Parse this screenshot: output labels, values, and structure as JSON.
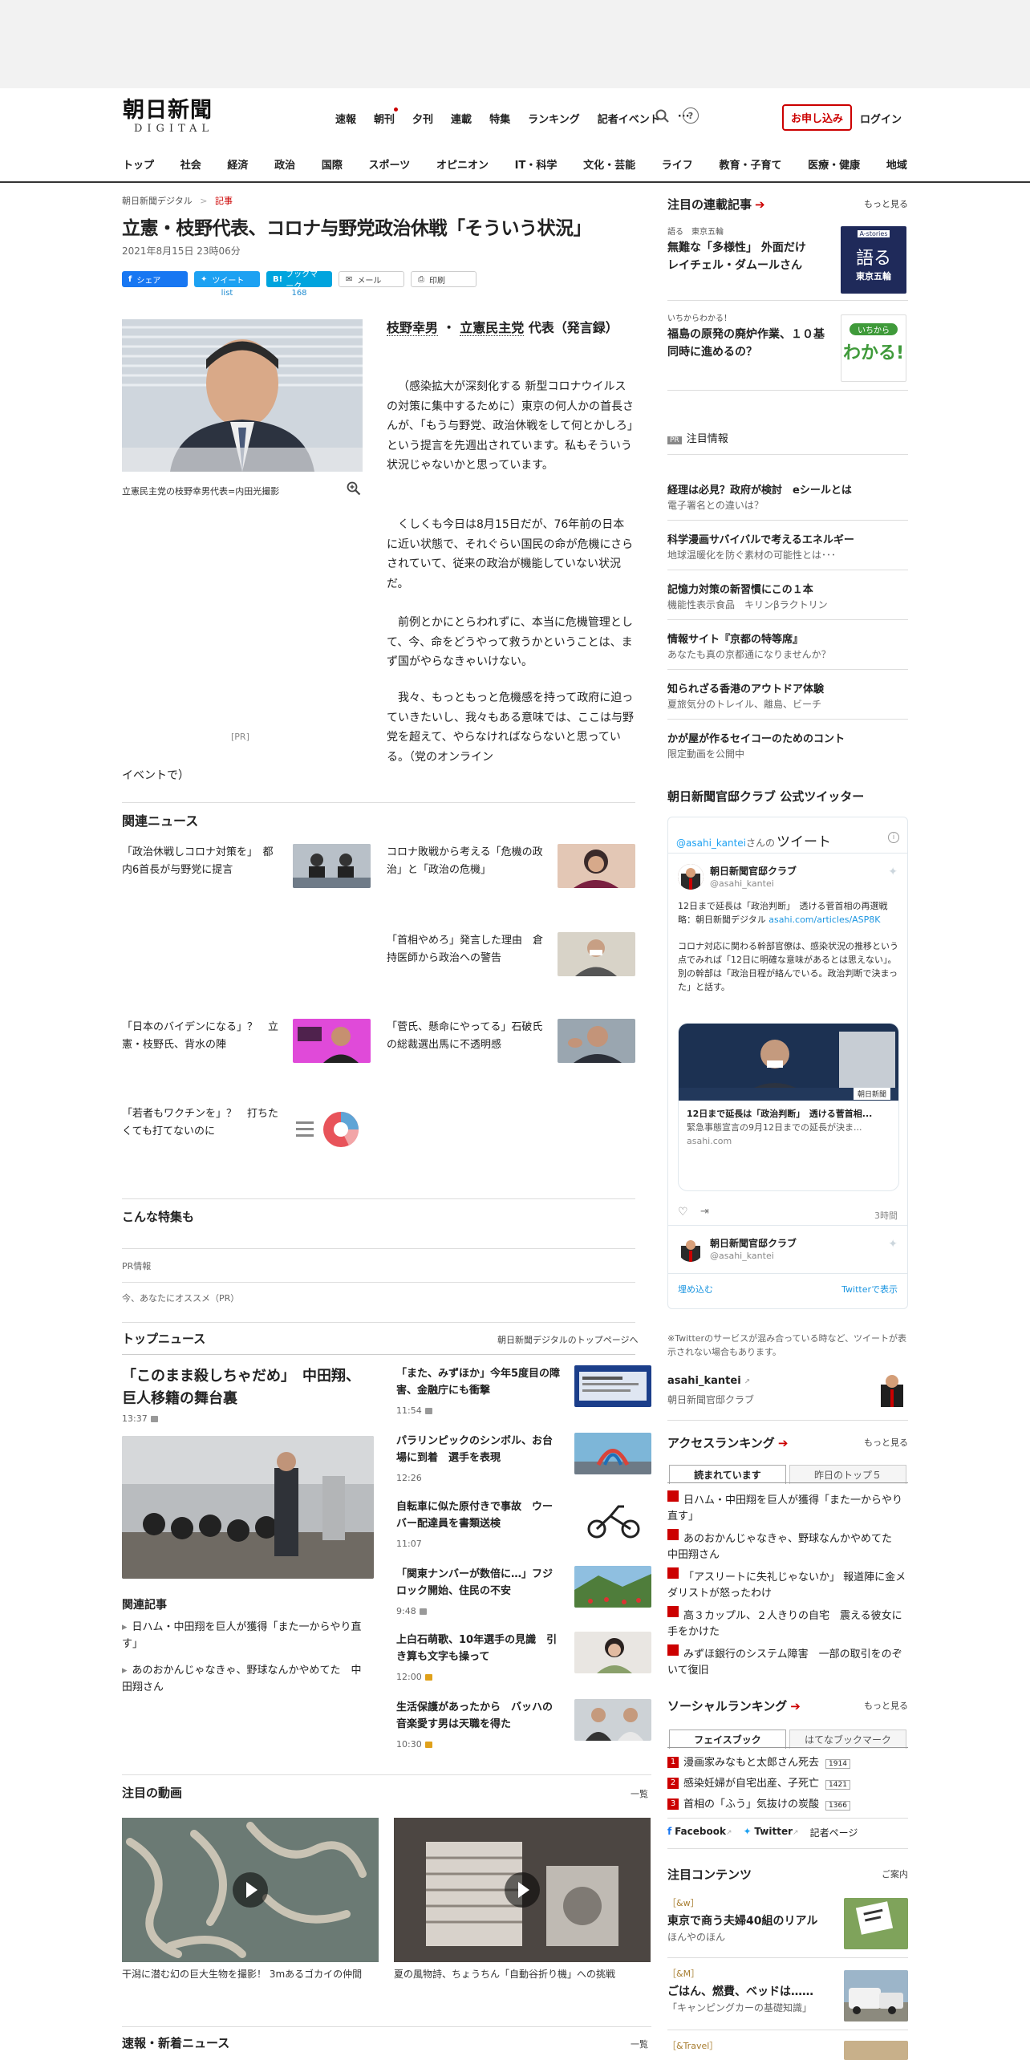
{
  "header": {
    "logo_jp": "朝日新聞",
    "logo_en": "DIGITAL",
    "nav": [
      "速報",
      "朝刊",
      "夕刊",
      "連載",
      "特集",
      "ランキング",
      "記者イベント"
    ],
    "more": "···",
    "subscribe": "お申し込み",
    "login": "ログイン",
    "categories": [
      "トップ",
      "社会",
      "経済",
      "政治",
      "国際",
      "スポーツ",
      "オピニオン",
      "IT・科学",
      "文化・芸能",
      "ライフ",
      "教育・子育て",
      "医療・健康",
      "地域"
    ]
  },
  "article": {
    "breadcrumb_home": "朝日新聞デジタル",
    "breadcrumb_sep": ">",
    "breadcrumb_cur": "記事",
    "title": "立憲・枝野代表、コロナ与野党政治休戦「そういう状況」",
    "date": "2021年8月15日 23時06分",
    "share": {
      "facebook": "シェア",
      "twitter": "ツイート",
      "twitter_count": "list",
      "hatena": "ブックマーク",
      "hatena_count": "168",
      "mail": "メール",
      "print": "印刷"
    },
    "photo_caption": "立憲民主党の枝野幸男代表=内田光撮影",
    "byline_name": "枝野幸男",
    "byline_sep": "・",
    "byline_party": "立憲民主党",
    "byline_rest": "代表（発言録）",
    "p1": "（感染拡大が深刻化する 新型コロナウイルス の対策に集中するために）東京の何人かの首長さんが、「もう与野党、政治休戦をして何とかしろ」という提言を先週出されています。私もそういう状況じゃないかと思っています。",
    "p2": "くしくも今日は8月15日だが、76年前の日本に近い状態で、それぐらい国民の命が危機にさらされていて、従来の政治が機能していない状況だ。",
    "p3": "前例とかにとらわれずに、本当に危機管理として、今、命をどうやって救うかということは、まず国がやらなきゃいけない。",
    "p4": "我々、もっともっと危機感を持って政府に迫っていきたいし、我々もある意味では、ここは与野党を超えて、やらなければならないと思っている。（党のオンライン",
    "pr": "[PR]",
    "tail": "イベントで）"
  },
  "related": {
    "heading": "関連ニュース",
    "items": [
      "「政治休戦しコロナ対策を」　都内6首長が与野党に提言",
      "コロナ敗戦から考える「危機の政治」と「政治の危機」",
      "「首相やめろ」発言した理由　倉持医師から政治への警告",
      "「日本のバイデンになる」？　立憲・枝野氏、背水の陣",
      "「菅氏、懸命にやってる」石破氏の総裁選出馬に不透明感",
      "「若者もワクチンを」？　打ちたくても打てないのに"
    ]
  },
  "feature": {
    "heading": "こんな特集も",
    "pr": "PR情報",
    "recommend": "今、あなたにオススメ（PR）"
  },
  "top_news": {
    "heading": "トップニュース",
    "link": "朝日新聞デジタルのトップページへ",
    "lead": "「このまま殺しちゃだめ」　中田翔、巨人移籍の舞台裏",
    "lead_time": "13:37",
    "related_heading": "関連記事",
    "related": [
      "日ハム・中田翔を巨人が獲得「また一からやり直す」",
      "あのおかんじゃなきゃ、野球なんかやめてた　中田翔さん"
    ],
    "items": [
      {
        "title": "「また、みずほか」今年5度目の障害、金融庁にも衝撃",
        "time": "11:54"
      },
      {
        "title": "パラリンピックのシンボル、お台場に到着　選手を表現",
        "time": "12:26"
      },
      {
        "title": "自転車に似た原付きで事故　ウーバー配達員を書類送検",
        "time": "11:07"
      },
      {
        "title": "「関東ナンバーが数倍に…」フジロック開始、住民の不安",
        "time": "9:48"
      },
      {
        "title": "上白石萌歌、10年選手の見識　引き算も文字も操って",
        "time": "12:00"
      },
      {
        "title": "生活保護があったから　バッハの音楽愛す男は天職を得た",
        "time": "10:30"
      }
    ]
  },
  "videos": {
    "heading": "注目の動画",
    "more": "一覧",
    "v1": "干潟に潜む幻の巨大生物を撮影！ 3mあるゴカイの仲間",
    "v2": "夏の風物詩、ちょうちん「自動谷折り機」への挑戦"
  },
  "breaking": {
    "heading": "速報・新着ニュース",
    "more": "一覧"
  },
  "sidebar": {
    "serial_heading": "注目の連載記事",
    "more": "もっと見る",
    "serial": [
      {
        "tag": "語る　東京五輪",
        "title": "無難な「多様性」 外面だけ　レイチェル・ダムールさん",
        "thumb": "語る",
        "thumb_sub": "東京五輪",
        "thumb_top": "A-stories"
      },
      {
        "tag": "いちからわかる！",
        "title": "福島の原発の廃炉作業、１０基同時に進めるの？",
        "thumb": "わかる!",
        "thumb_top": "いちから"
      }
    ],
    "pr_label": "PR",
    "pr_heading": "注目情報",
    "pr_items": [
      {
        "t": "経理は必見？政府が検討　eシールとは",
        "s": "電子署名との違いは？"
      },
      {
        "t": "科学漫画サバイバルで考えるエネルギー",
        "s": "地球温暖化を防ぐ素材の可能性とは･･･"
      },
      {
        "t": "記憶力対策の新習慣にこの１本",
        "s": "機能性表示食品　キリンβラクトリン"
      },
      {
        "t": "情報サイト『京都の特等席』",
        "s": "あなたも真の京都通になりませんか？"
      },
      {
        "t": "知られざる香港のアウトドア体験",
        "s": "夏旅気分のトレイル、離島、ビーチ"
      },
      {
        "t": "かが屋が作るセイコーのためのコント",
        "s": "限定動画を公開中"
      }
    ],
    "twitter_heading": "朝日新聞官邸クラブ 公式ツイッター",
    "tw_handle_link": "@asahi_kantei",
    "tw_san": "さんの",
    "tw_tweet": "ツイート",
    "tw_name": "朝日新聞官邸クラブ",
    "tw_handle": "@asahi_kantei",
    "tw_text1": "12日まで延長は「政治判断」　透ける菅首相の再選戦略：朝日新聞デジタル ",
    "tw_link": "asahi.com/articles/ASP8K",
    "tw_text2": "コロナ対応に関わる幹部官僚は、感染状況の推移という点でみれば「12日に明確な意味があるとは思えない」。別の幹部は「政治日程が絡んでいる。政治判断で決まった」と話す。",
    "card_title": "12日まで延長は「政治判断」　透ける菅首相...",
    "card_desc": "緊急事態宣言の9月12日までの延長が決ま...",
    "card_domain": "asahi.com",
    "card_brand": "朝日新聞",
    "tw_time": "3時間",
    "embed": "埋め込む",
    "view_on": "Twitterで表示",
    "tw_note": "※Twitterのサービスが混み合っている時など、ツイートが表示されない場合もあります。",
    "account_handle": "asahi_kantei",
    "account_name": "朝日新聞官邸クラブ",
    "access_heading": "アクセスランキング",
    "access_tabs": [
      "読まれています",
      "昨日のトップ５"
    ],
    "access": [
      "日ハム・中田翔を巨人が獲得「また一からやり直す」",
      "あのおかんじゃなきゃ、野球なんかやめてた　中田翔さん",
      "「アスリートに失礼じゃないか」 報道陣に金メダリストが怒ったわけ",
      "高３カップル、２人きりの自宅　震える彼女に手をかけた",
      "みずほ銀行のシステム障害　一部の取引をのぞいて復旧"
    ],
    "social_heading": "ソーシャルランキング",
    "social_tabs": [
      "フェイスブック",
      "はてなブックマーク"
    ],
    "social": [
      {
        "n": "1",
        "t": "漫画家みなもと太郎さん死去",
        "c": "1914"
      },
      {
        "n": "2",
        "t": "感染妊婦が自宅出産、子死亡",
        "c": "1421"
      },
      {
        "n": "3",
        "t": "首相の「ふう」気抜けの炭酸",
        "c": "1366"
      }
    ],
    "social_links": [
      "Facebook",
      "Twitter",
      "記者ページ"
    ],
    "content_heading": "注目コンテンツ",
    "content_more": "ご案内",
    "contents": [
      {
        "tag": "［&w］",
        "t": "東京で商う夫婦40組のリアル",
        "s": "ほんやのほん"
      },
      {
        "tag": "［&M］",
        "t": "ごはん、燃費、ベッドは……",
        "s": "「キャンピングカーの基礎知識」"
      },
      {
        "tag": "［&Travel］"
      }
    ]
  },
  "colors": {
    "brand_red": "#cc0000",
    "twitter_blue": "#1da1f2",
    "facebook": "#1877f2",
    "hatena": "#00a4de"
  }
}
